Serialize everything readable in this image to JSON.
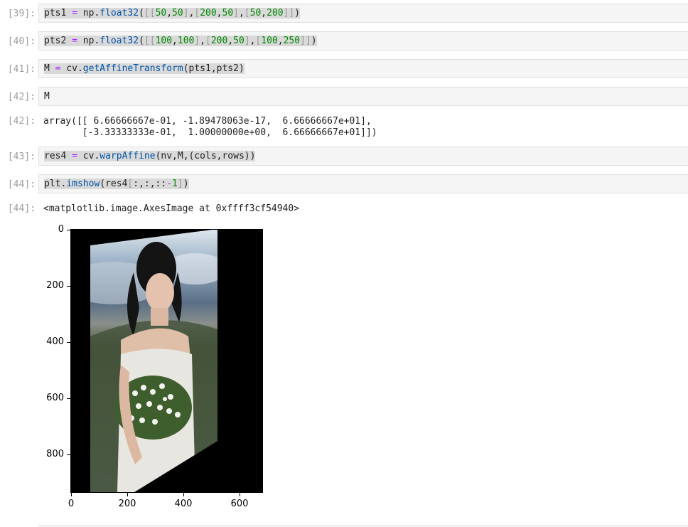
{
  "cells": [
    {
      "prompt": "[39]:",
      "code": "pts1 = np.float32([[50,50],[200,50],[50,200]])"
    },
    {
      "prompt": "[40]:",
      "code": "pts2 = np.float32([[100,100],[200,50],[100,250]])"
    },
    {
      "prompt": "[41]:",
      "code": "M = cv.getAffineTransform(pts1,pts2)"
    },
    {
      "prompt": "[42]:",
      "code": "M"
    },
    {
      "prompt": "[43]:",
      "code": "res4 = cv.warpAffine(nv,M,(cols,rows))"
    },
    {
      "prompt": "[44]:",
      "code": "plt.imshow(res4[:,:,::-1])"
    }
  ],
  "outputs": {
    "out42_prompt": "[42]:",
    "out42_line1": "array([[ 6.66666667e-01, -1.89478063e-17,  6.66666667e+01],",
    "out42_line2": "       [-3.33333333e-01,  1.00000000e+00,  6.66666667e+01]])",
    "out44_prompt": "[44]:",
    "out44_text": "<matplotlib.image.AxesImage at 0xffff3cf54940>"
  },
  "chart_data": {
    "type": "image",
    "yticks": [
      "0",
      "200",
      "400",
      "600",
      "800"
    ],
    "xticks": [
      "0",
      "200",
      "400",
      "600"
    ],
    "image_description": "Affine-warped photo of a woman in a white dress holding white flowers, mountain landscape and cloudy sky, on black background"
  }
}
